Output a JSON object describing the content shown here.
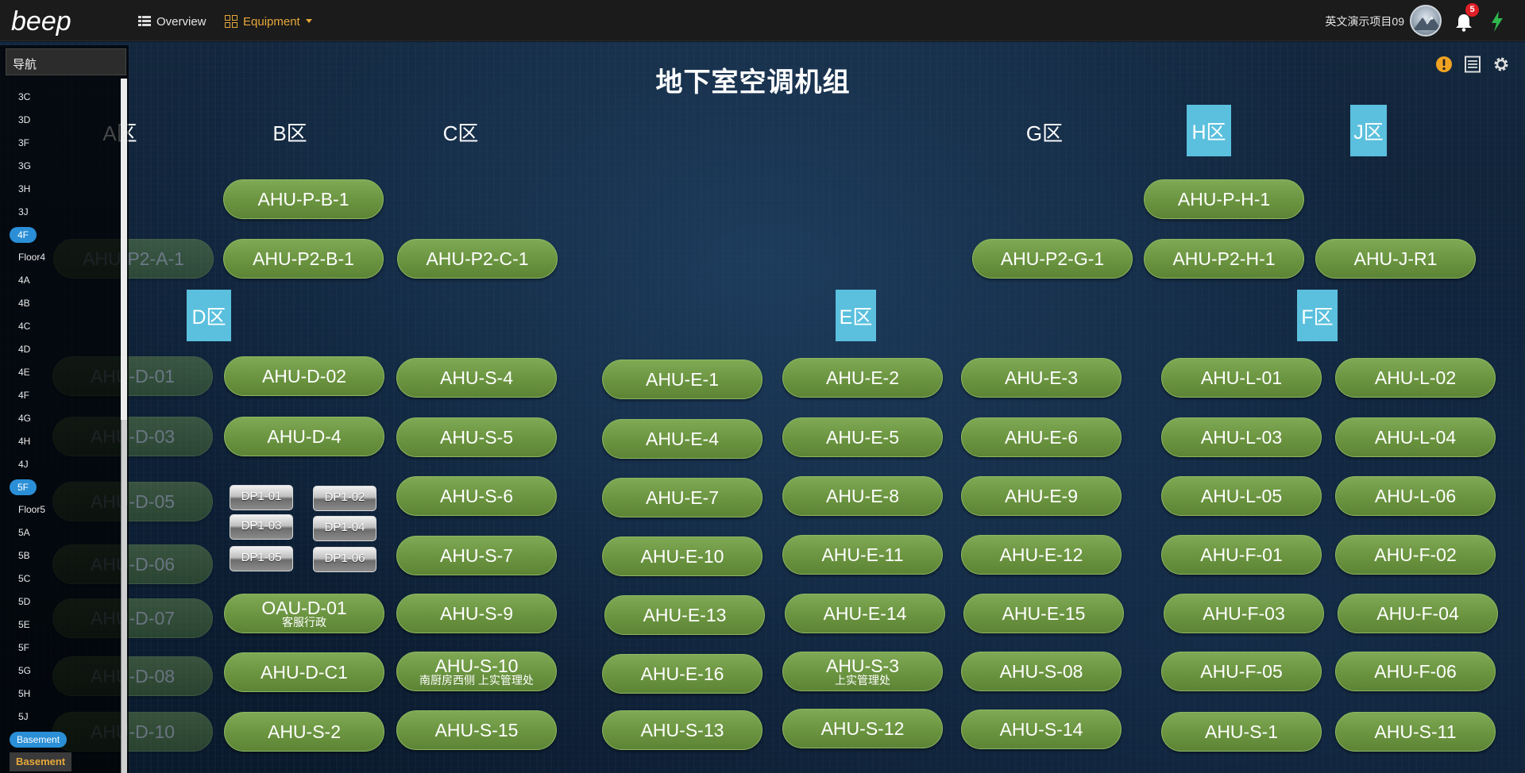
{
  "header": {
    "logo_text": "beep",
    "nav": [
      {
        "label": "Overview",
        "icon": "overview-grid-icon"
      },
      {
        "label": "Equipment",
        "icon": "equipment-grid-icon",
        "active": true
      }
    ],
    "project": "英文演示项目09",
    "notifications": "5",
    "accent_color": "#e7a83a"
  },
  "nav_panel": {
    "title": "导航",
    "items": [
      "3C",
      "3D",
      "3F",
      "3G",
      "3H",
      "3J",
      "4F",
      "Floor4",
      "4A",
      "4B",
      "4C",
      "4D",
      "4E",
      "4F",
      "4G",
      "4H",
      "4J",
      "5F",
      "Floor5",
      "5A",
      "5B",
      "5C",
      "5D",
      "5E",
      "5F",
      "5G",
      "5H",
      "5J",
      "Basement"
    ],
    "active_items": [
      "4F (row 7)",
      "5F (row 18)",
      "Basement (row 29)"
    ],
    "footer_item": "Basement"
  },
  "page": {
    "title": "地下室空调机组",
    "zones": {
      "A": "A区",
      "B": "B区",
      "C": "C区",
      "G": "G区",
      "H": "H区",
      "J": "J区",
      "D": "D区",
      "E": "E区",
      "F": "F区"
    },
    "units": {
      "pb1": "AHU-P-B-1",
      "ph1": "AHU-P-H-1",
      "p2a1": "AHU-P2-A-1",
      "p2b1": "AHU-P2-B-1",
      "p2c1": "AHU-P2-C-1",
      "p2g1": "AHU-P2-G-1",
      "p2h1": "AHU-P2-H-1",
      "jr1": "AHU-J-R1",
      "d01": "AHU-D-01",
      "d02": "AHU-D-02",
      "s4": "AHU-S-4",
      "e1": "AHU-E-1",
      "e2": "AHU-E-2",
      "e3": "AHU-E-3",
      "l01": "AHU-L-01",
      "l02": "AHU-L-02",
      "d03": "AHU-D-03",
      "d4": "AHU-D-4",
      "s5": "AHU-S-5",
      "e4": "AHU-E-4",
      "e5": "AHU-E-5",
      "e6": "AHU-E-6",
      "l03": "AHU-L-03",
      "l04": "AHU-L-04",
      "d05": "AHU-D-05",
      "s6": "AHU-S-6",
      "e7": "AHU-E-7",
      "e8": "AHU-E-8",
      "e9": "AHU-E-9",
      "l05": "AHU-L-05",
      "l06": "AHU-L-06",
      "d06": "AHU-D-06",
      "s7": "AHU-S-7",
      "e10": "AHU-E-10",
      "e11": "AHU-E-11",
      "e12": "AHU-E-12",
      "f01": "AHU-F-01",
      "f02": "AHU-F-02",
      "d07": "AHU-D-07",
      "oaud01": "OAU-D-01",
      "oaud01_sub": "客服行政",
      "s9": "AHU-S-9",
      "e13": "AHU-E-13",
      "e14": "AHU-E-14",
      "e15": "AHU-E-15",
      "f03": "AHU-F-03",
      "f04": "AHU-F-04",
      "d08": "AHU-D-08",
      "dc1": "AHU-D-C1",
      "s10": "AHU-S-10",
      "s10_sub": "南厨房西侧 上实管理处",
      "e16": "AHU-E-16",
      "s3": "AHU-S-3",
      "s3_sub": "上实管理处",
      "s08": "AHU-S-08",
      "f05": "AHU-F-05",
      "f06": "AHU-F-06",
      "d10": "AHU-D-10",
      "s2": "AHU-S-2",
      "s15": "AHU-S-15",
      "s13": "AHU-S-13",
      "s12": "AHU-S-12",
      "s14": "AHU-S-14",
      "s1": "AHU-S-1",
      "s11": "AHU-S-11"
    },
    "dp_units": {
      "dp01": "DP1-01",
      "dp02": "DP1-02",
      "dp03": "DP1-03",
      "dp04": "DP1-04",
      "dp05": "DP1-05",
      "dp06": "DP1-06"
    },
    "tools": [
      "alert-icon",
      "list-icon",
      "settings-icon"
    ],
    "colors": {
      "unit_green": "#6b9440",
      "zone_blue": "#5bc0de",
      "active_nav": "#2a8fd6"
    }
  }
}
